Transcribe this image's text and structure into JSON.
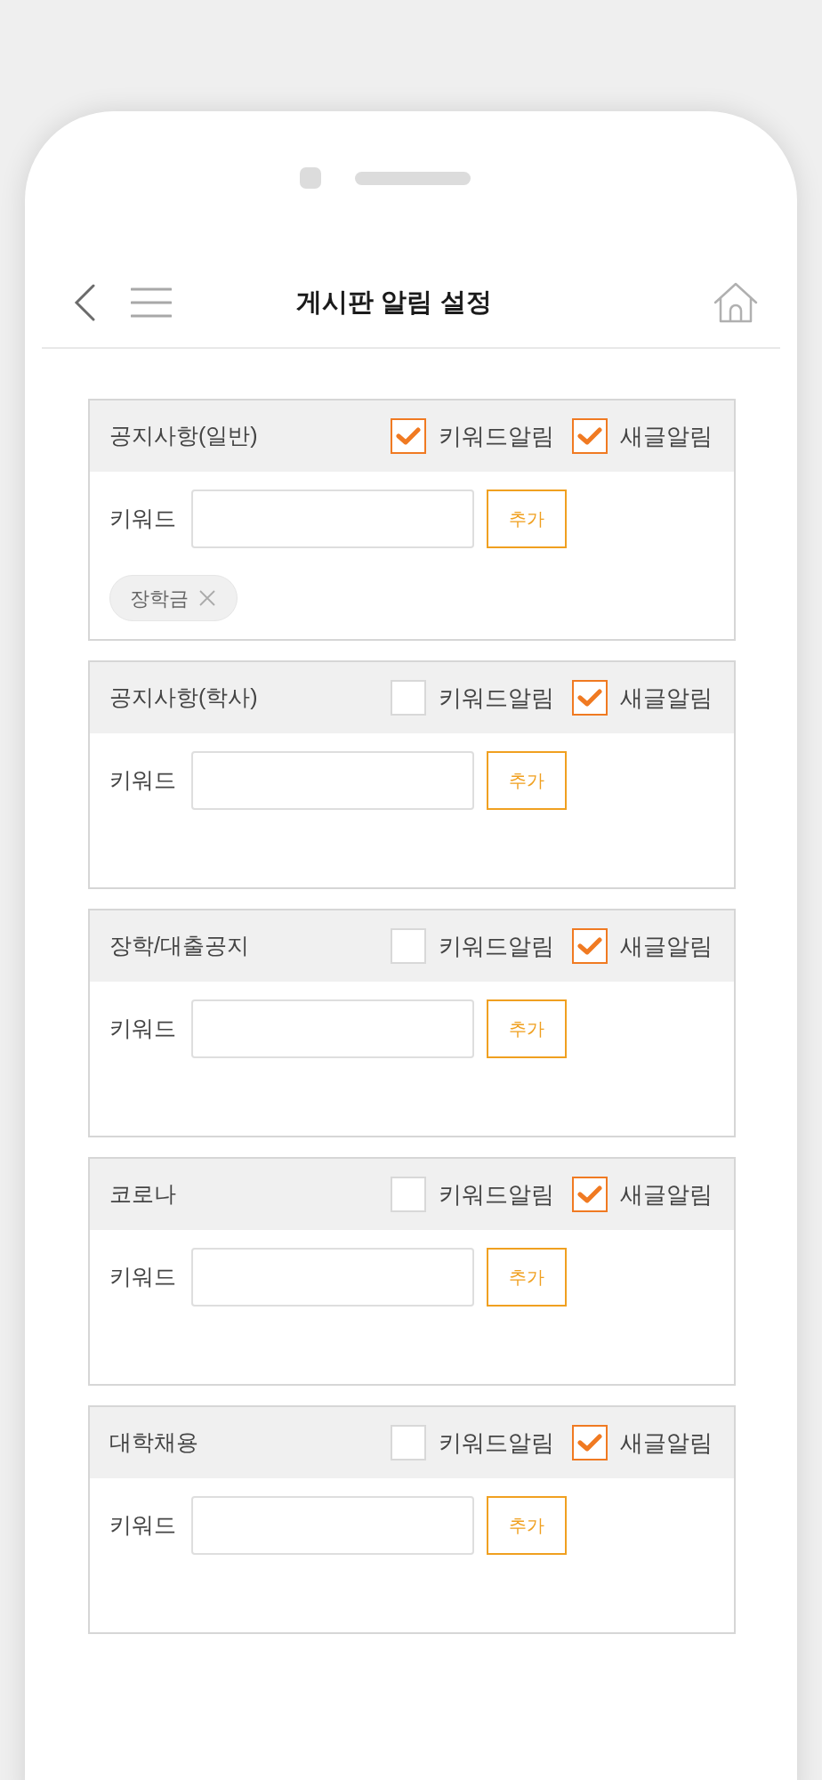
{
  "header": {
    "title": "게시판 알림 설정"
  },
  "boards": [
    {
      "name": "공지사항(일반)",
      "options": [
        {
          "label": "키워드알림",
          "checked": true
        },
        {
          "label": "새글알림",
          "checked": true
        }
      ],
      "keyword_label": "키워드",
      "add_button": "추가",
      "tags": [
        {
          "label": "장학금"
        }
      ]
    },
    {
      "name": "공지사항(학사)",
      "options": [
        {
          "label": "키워드알림",
          "checked": false
        },
        {
          "label": "새글알림",
          "checked": true
        }
      ],
      "keyword_label": "키워드",
      "add_button": "추가"
    },
    {
      "name": "장학/대출공지",
      "options": [
        {
          "label": "키워드알림",
          "checked": false
        },
        {
          "label": "새글알림",
          "checked": true
        }
      ],
      "keyword_label": "키워드",
      "add_button": "추가"
    },
    {
      "name": "코로나",
      "options": [
        {
          "label": "키워드알림",
          "checked": false
        },
        {
          "label": "새글알림",
          "checked": true
        }
      ],
      "keyword_label": "키워드",
      "add_button": "추가"
    },
    {
      "name": "대학채용",
      "options": [
        {
          "label": "키워드알림",
          "checked": false
        },
        {
          "label": "새글알림",
          "checked": true
        }
      ],
      "keyword_label": "키워드",
      "add_button": "추가"
    }
  ]
}
